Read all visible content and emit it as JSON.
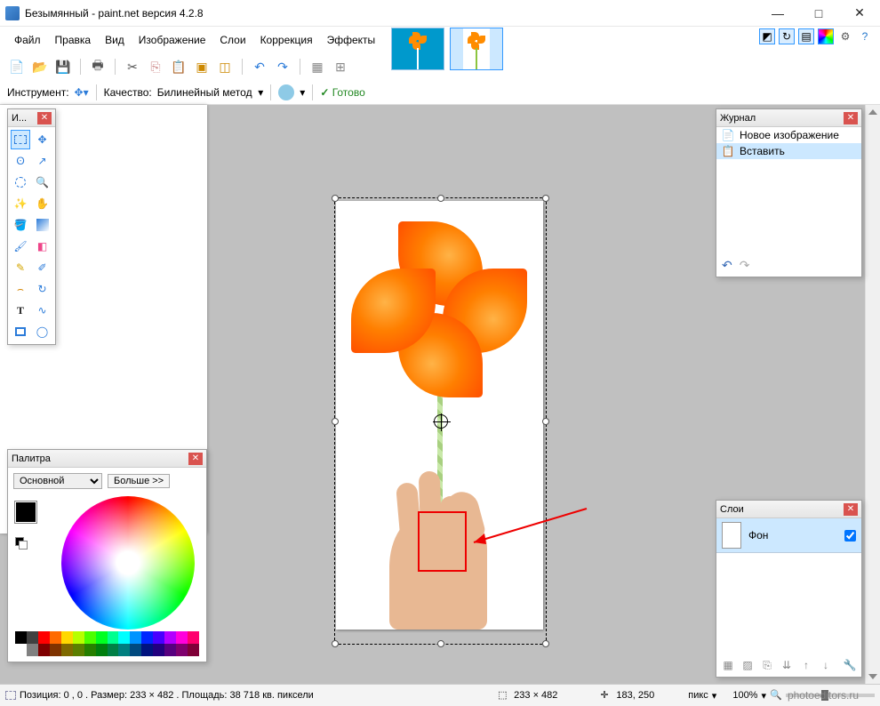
{
  "title": "Безымянный - paint.net версия 4.2.8",
  "menu": [
    "Файл",
    "Правка",
    "Вид",
    "Изображение",
    "Слои",
    "Коррекция",
    "Эффекты"
  ],
  "toolbar2": {
    "tool_label": "Инструмент:",
    "quality_label": "Качество:",
    "sampling_method": "Билинейный метод",
    "ready": "Готово"
  },
  "tools_panel": {
    "title": "И..."
  },
  "history_panel": {
    "title": "Журнал",
    "items": [
      "Новое изображение",
      "Вставить"
    ]
  },
  "layers_panel": {
    "title": "Слои",
    "layer_name": "Фон",
    "visible": true
  },
  "palette_panel": {
    "title": "Палитра",
    "primary_label": "Основной",
    "more_label": "Больше >>"
  },
  "status": {
    "info": "Позиция: 0 , 0 . Размер: 233  × 482 . Площадь: 38 718 кв. пиксели",
    "dims": "233 × 482",
    "cursor": "183, 250",
    "unit": "пикс",
    "zoom": "100%"
  },
  "watermark": "photoeditors.ru",
  "palette_colors_row1": [
    "#000",
    "#404040",
    "#ff0000",
    "#ff6a00",
    "#ffd800",
    "#b6ff00",
    "#4cff00",
    "#00ff21",
    "#00ff90",
    "#00ffff",
    "#0094ff",
    "#0026ff",
    "#4800ff",
    "#b200ff",
    "#ff00dc",
    "#ff006e"
  ],
  "palette_colors_row2": [
    "#fff",
    "#808080",
    "#7f0000",
    "#7f3300",
    "#7f6a00",
    "#5b7f00",
    "#267f00",
    "#007f0e",
    "#007f46",
    "#007f7f",
    "#004a7f",
    "#00137f",
    "#21007f",
    "#57007f",
    "#7f006e",
    "#7f0037"
  ]
}
